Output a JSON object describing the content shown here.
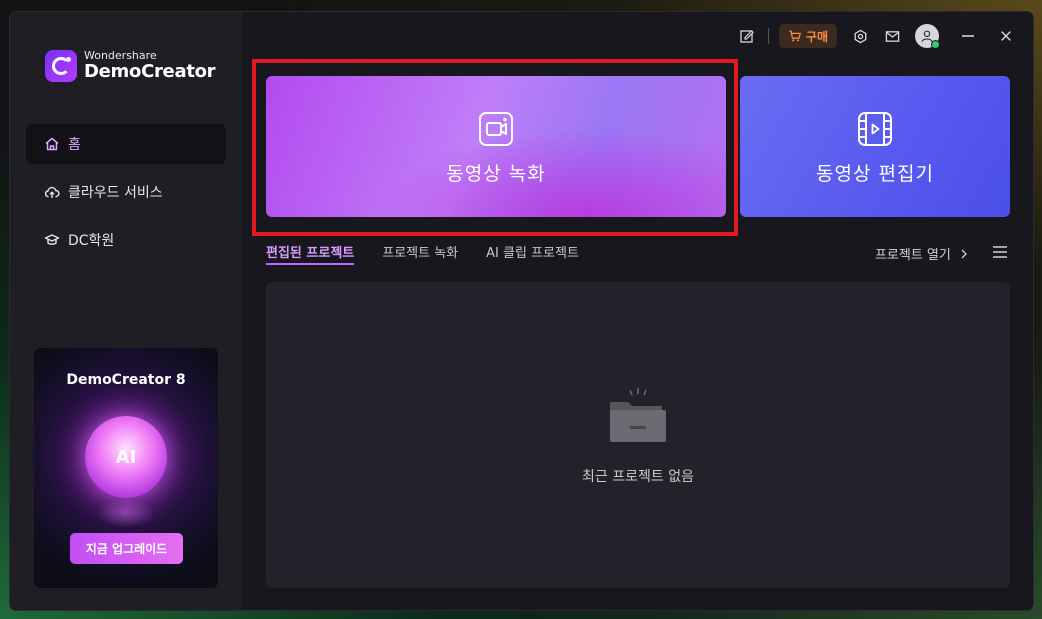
{
  "app": {
    "brand_small": "Wondershare",
    "brand_name": "DemoCreator"
  },
  "sidebar": {
    "items": [
      {
        "label": "홈",
        "icon": "home-icon",
        "active": true
      },
      {
        "label": "클라우드 서비스",
        "icon": "cloud-upload-icon",
        "active": false
      },
      {
        "label": "DC학원",
        "icon": "graduation-cap-icon",
        "active": false
      }
    ],
    "promo": {
      "title": "DemoCreator 8",
      "orb_text": "AI",
      "button_label": "지금 업그레이드"
    }
  },
  "titlebar": {
    "buy_label": "구매",
    "icons": [
      "edit-note-icon",
      "cart-icon",
      "settings-icon",
      "mail-icon",
      "user-icon",
      "minimize-icon",
      "close-icon"
    ]
  },
  "cards": {
    "record": {
      "label": "동영상 녹화",
      "icon": "camera-icon"
    },
    "edit": {
      "label": "동영상 편집기",
      "icon": "film-icon"
    }
  },
  "tabs": [
    {
      "label": "편집된 프로젝트",
      "active": true
    },
    {
      "label": "프로젝트 녹화",
      "active": false
    },
    {
      "label": "AI 클립 프로젝트",
      "active": false
    }
  ],
  "open_project_label": "프로젝트 열기",
  "empty_state": {
    "text": "최근 프로젝트 없음"
  },
  "colors": {
    "accent": "#b86bff",
    "buy": "#ff8a3d",
    "highlight": "#e11a22"
  }
}
